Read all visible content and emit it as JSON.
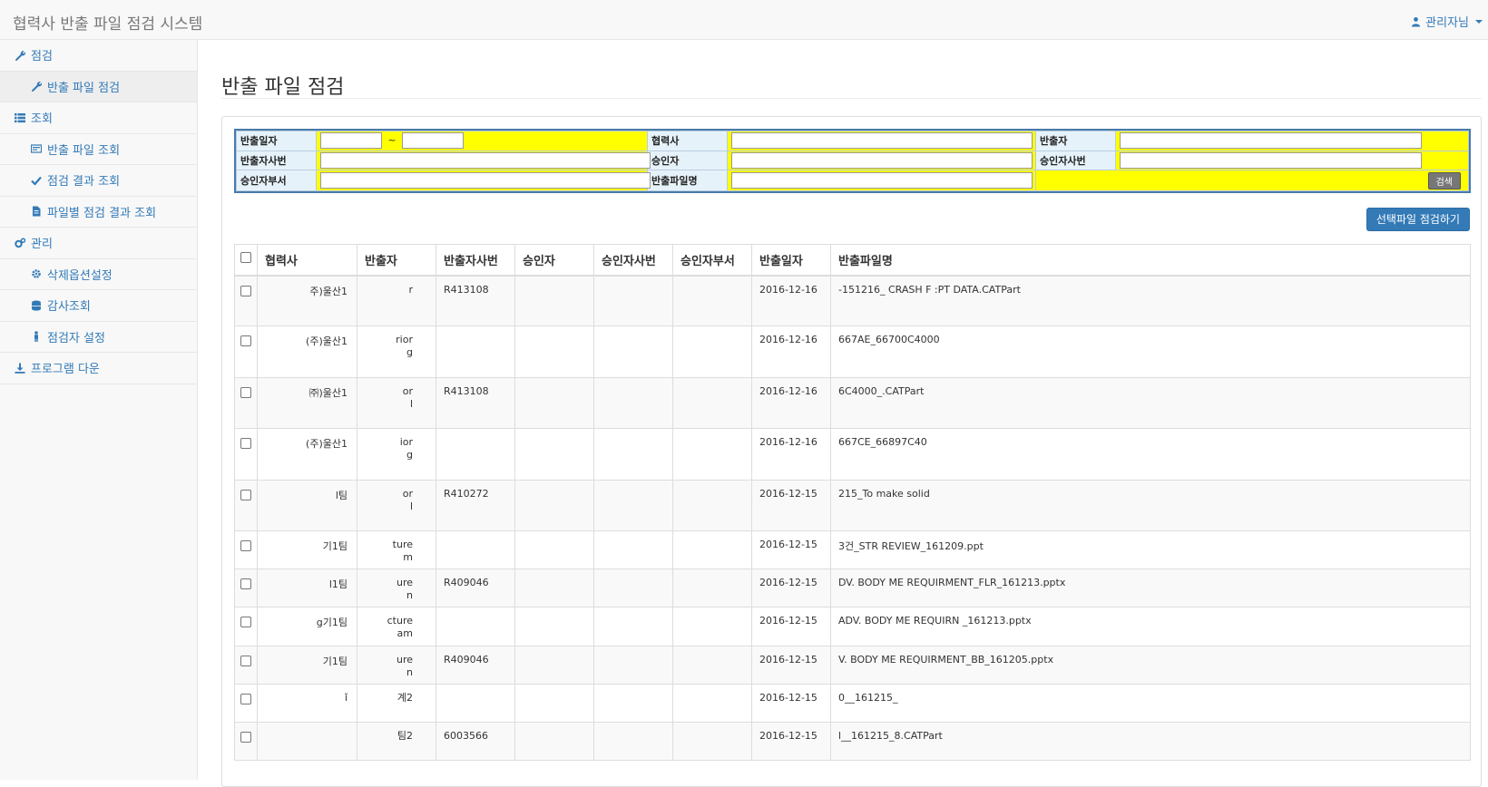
{
  "header": {
    "brand": "협력사 반출 파일 점검 시스템",
    "user": "관리자님"
  },
  "sidebar": {
    "items": [
      {
        "label": "점검",
        "icon": "wrench-icon",
        "level": 0
      },
      {
        "label": "반출 파일 점검",
        "icon": "wrench-icon",
        "level": 1,
        "active": true
      },
      {
        "label": "조회",
        "icon": "list-icon",
        "level": 0
      },
      {
        "label": "반출 파일 조회",
        "icon": "card-icon",
        "level": 1
      },
      {
        "label": "점검 결과 조회",
        "icon": "check-icon",
        "level": 1
      },
      {
        "label": "파일별 점검 결과 조회",
        "icon": "file-icon",
        "level": 1
      },
      {
        "label": "관리",
        "icon": "gears-icon",
        "level": 0
      },
      {
        "label": "삭제옵션설정",
        "icon": "gear-icon",
        "level": 1
      },
      {
        "label": "감사조회",
        "icon": "database-icon",
        "level": 1
      },
      {
        "label": "점검자 설정",
        "icon": "person-icon",
        "level": 1
      },
      {
        "label": "프로그램 다운",
        "icon": "download-icon",
        "level": 0
      }
    ]
  },
  "page": {
    "title": "반출 파일 점검"
  },
  "search": {
    "date_label": "반출일자",
    "date_tilde": "~",
    "vendor_label": "협력사",
    "sender_label": "반출자",
    "sender_id_label": "반출자사번",
    "approver_label": "승인자",
    "approver_id_label": "승인자사번",
    "approver_dept_label": "승인자부서",
    "filename_label": "반출파일명",
    "search_button": "검색"
  },
  "actions": {
    "check_selected": "선택파일 점검하기"
  },
  "table": {
    "headers": [
      "협력사",
      "반출자",
      "반출자사번",
      "승인자",
      "승인자사번",
      "승인자부서",
      "반출일자",
      "반출파일명"
    ],
    "rows": [
      {
        "vendor": "주)울산1",
        "sender": "r",
        "sender_id": "R413108",
        "approver": "",
        "approver_id": "",
        "approver_dept": "",
        "date": "2016-12-16",
        "file": "-151216_ CRASH F                    :PT DATA.CATPart"
      },
      {
        "vendor": "(주)울산1",
        "sender": "rior\ng",
        "sender_id": "",
        "approver": "",
        "approver_id": "",
        "approver_dept": "",
        "date": "2016-12-16",
        "file": "667AE_66700C4000"
      },
      {
        "vendor": "㈜)울산1",
        "sender": "or\nl",
        "sender_id": "R413108",
        "approver": "",
        "approver_id": "",
        "approver_dept": "",
        "date": "2016-12-16",
        "file": "6C4000_.CATPart"
      },
      {
        "vendor": "(주)울산1",
        "sender": "ior\ng",
        "sender_id": "",
        "approver": "",
        "approver_id": "",
        "approver_dept": "",
        "date": "2016-12-16",
        "file": "667CE_66897C40"
      },
      {
        "vendor": "l팀",
        "sender": "or\nl",
        "sender_id": "R410272",
        "approver": "",
        "approver_id": "",
        "approver_dept": "",
        "date": "2016-12-15",
        "file": "215_To make solid"
      },
      {
        "vendor": "기1팀",
        "sender": "ture\nm",
        "sender_id": "",
        "approver": "",
        "approver_id": "",
        "approver_dept": "",
        "date": "2016-12-15",
        "file": "3건_STR REVIEW_161209.ppt"
      },
      {
        "vendor": "l1팀",
        "sender": "ure\nn",
        "sender_id": "R409046",
        "approver": "",
        "approver_id": "",
        "approver_dept": "",
        "date": "2016-12-15",
        "file": "DV. BODY ME REQUIRMENT_FLR_161213.pptx"
      },
      {
        "vendor": "g기1팀",
        "sender": "cture\nam",
        "sender_id": "",
        "approver": "",
        "approver_id": "",
        "approver_dept": "",
        "date": "2016-12-15",
        "file": "ADV. BODY ME REQUIRN                 _161213.pptx"
      },
      {
        "vendor": "기1팀",
        "sender": "ure\nn",
        "sender_id": "R409046",
        "approver": "",
        "approver_id": "",
        "approver_dept": "",
        "date": "2016-12-15",
        "file": "V. BODY ME REQUIRMENT_BB_161205.pptx"
      },
      {
        "vendor": "ǐ",
        "sender": "계2",
        "sender_id": "",
        "approver": "",
        "approver_id": "",
        "approver_dept": "",
        "date": "2016-12-15",
        "file": "0__161215_"
      },
      {
        "vendor": "",
        "sender": "팀2",
        "sender_id": "6003566",
        "approver": "",
        "approver_id": "",
        "approver_dept": "",
        "date": "2016-12-15",
        "file": "l__161215_8.CATPart"
      }
    ]
  }
}
